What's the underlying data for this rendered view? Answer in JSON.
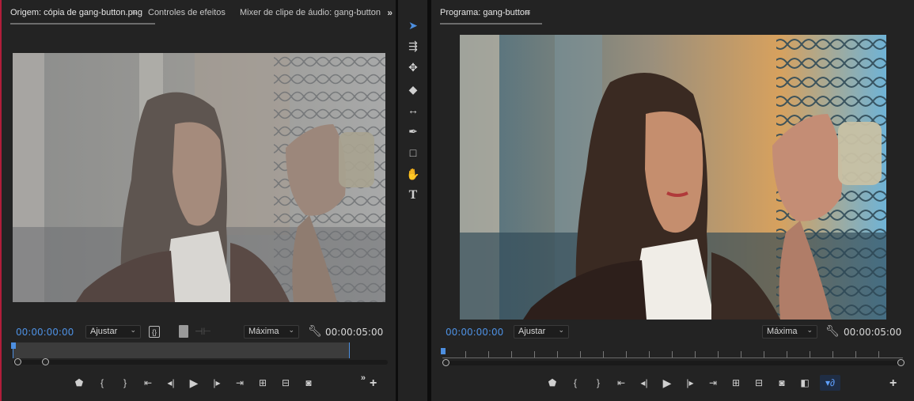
{
  "source": {
    "tabs": [
      {
        "label": "Origem: cópia de gang-button.png",
        "active": true
      },
      {
        "label": "Controles de efeitos",
        "active": false
      },
      {
        "label": "Mixer de clipe de áudio: gang-button",
        "active": false
      }
    ],
    "menu_glyph": "≡",
    "overflow_glyph": "»",
    "timecode_current": "00:00:00:00",
    "timecode_duration": "00:00:05:00",
    "fit_select": "Ajustar",
    "quality_select": "Máxima",
    "controls": [
      "marker-icon",
      "mark-in-icon",
      "mark-out-icon",
      "go-to-in-icon",
      "step-back-icon",
      "play-icon",
      "step-forward-icon",
      "go-to-out-icon",
      "insert-icon",
      "overwrite-icon",
      "export-frame-icon"
    ]
  },
  "program": {
    "tab": {
      "label": "Programa: gang-button",
      "active": true
    },
    "menu_glyph": "≡",
    "timecode_current": "00:00:00:00",
    "timecode_duration": "00:00:05:00",
    "fit_select": "Ajustar",
    "quality_select": "Máxima",
    "controls": [
      "marker-icon",
      "mark-in-icon",
      "mark-out-icon",
      "go-to-in-icon",
      "step-back-icon",
      "play-icon",
      "step-forward-icon",
      "go-to-out-icon",
      "lift-icon",
      "extract-icon",
      "export-frame-icon",
      "comparison-view-icon",
      "proxy-toggle-icon"
    ]
  },
  "tools": [
    "selection-tool-icon",
    "track-select-tool-icon",
    "ripple-edit-tool-icon",
    "razor-tool-icon",
    "slip-tool-icon",
    "pen-tool-icon",
    "rectangle-tool-icon",
    "hand-tool-icon",
    "type-tool-icon"
  ],
  "colors": {
    "accent": "#4d8fe0",
    "panel": "#232323",
    "active_border": "#b01d3a"
  }
}
